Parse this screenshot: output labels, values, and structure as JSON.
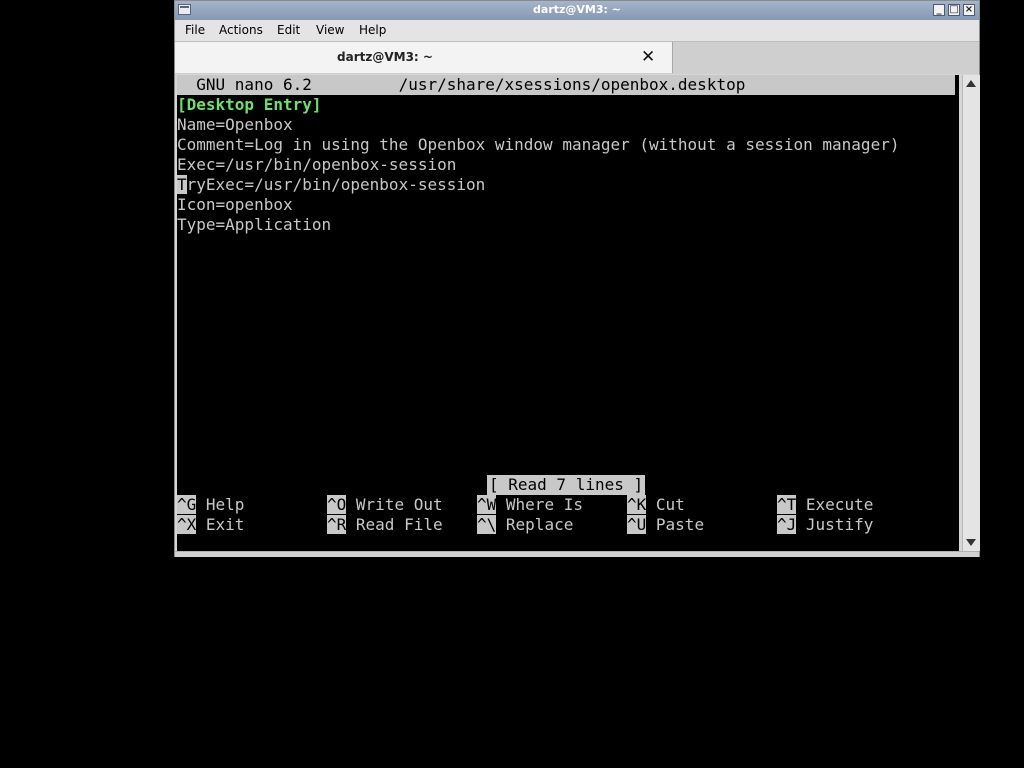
{
  "window": {
    "title": "dartz@VM3: ~"
  },
  "menu": [
    "File",
    "Actions",
    "Edit",
    "View",
    "Help"
  ],
  "tab": {
    "label": "dartz@VM3: ~",
    "close_glyph": "✕"
  },
  "nano": {
    "header_left": "GNU nano 6.2",
    "header_file": "/usr/share/xsessions/openbox.desktop",
    "lines": [
      "[Desktop Entry]",
      "Name=Openbox",
      "Comment=Log in using the Openbox window manager (without a session manager)",
      "Exec=/usr/bin/openbox-session",
      "TryExec=/usr/bin/openbox-session",
      "Icon=openbox",
      "Type=Application"
    ],
    "cursor_char": "T",
    "cursor_rest": "ryExec=/usr/bin/openbox-session",
    "status": "[ Read 7 lines ]",
    "shortcuts_row1": [
      {
        "key": "^G",
        "label": "Help"
      },
      {
        "key": "^O",
        "label": "Write Out"
      },
      {
        "key": "^W",
        "label": "Where Is"
      },
      {
        "key": "^K",
        "label": "Cut"
      },
      {
        "key": "^T",
        "label": "Execute"
      }
    ],
    "shortcuts_row2": [
      {
        "key": "^X",
        "label": "Exit"
      },
      {
        "key": "^R",
        "label": "Read File"
      },
      {
        "key": "^\\",
        "label": "Replace"
      },
      {
        "key": "^U",
        "label": "Paste"
      },
      {
        "key": "^J",
        "label": "Justify"
      }
    ]
  },
  "icons": {
    "window": "terminal-window-icon",
    "minimize": "minimize-icon",
    "maximize": "maximize-icon",
    "close": "close-icon"
  },
  "colors": {
    "terminal_bg": "#000000",
    "terminal_fg": "#c8c8c8",
    "section_header": "#6fe06f",
    "titlebar": "#8fa0ba"
  }
}
